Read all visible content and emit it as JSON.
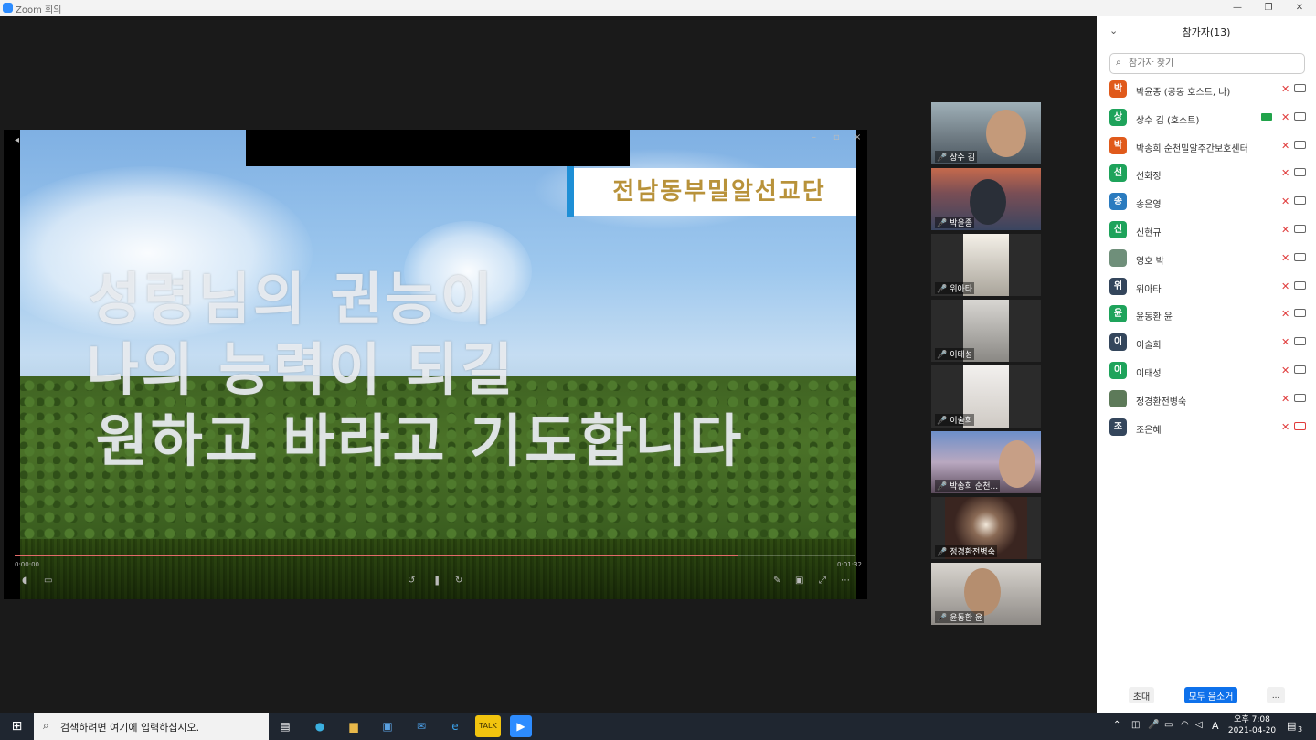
{
  "window": {
    "title": "Zoom 회의",
    "controls": [
      "—",
      "❐",
      "✕"
    ]
  },
  "share": {
    "banner": "전남동부밀알선교단",
    "lyrics": [
      "성령님의 권능이",
      "나의 능력이 되길",
      "원하고 바라고 기도합니다"
    ],
    "playback_progress": 0.86,
    "time_left": "0:00:00",
    "time_right": "0:01:32"
  },
  "gallery": [
    {
      "name": "상수 김",
      "active": false
    },
    {
      "name": "박윤종",
      "active": false
    },
    {
      "name": "위아타",
      "active": false
    },
    {
      "name": "이태성",
      "active": false
    },
    {
      "name": "이술희",
      "active": false
    },
    {
      "name": "박송희 순천...",
      "active": false
    },
    {
      "name": "정경환전병숙",
      "active": true
    },
    {
      "name": "윤동환 윤",
      "active": false
    }
  ],
  "participants_panel": {
    "title": "참가자(13)",
    "search_placeholder": "참가자 찾기",
    "participants": [
      {
        "initial": "박",
        "name": "박윤종 (공동 호스트, 나)",
        "color": "#e05a1b",
        "sharing": false,
        "video_off": false
      },
      {
        "initial": "상",
        "name": "상수 김 (호스트)",
        "color": "#1ea35b",
        "sharing": true,
        "video_off": false
      },
      {
        "initial": "박",
        "name": "박송희 순천밀알주간보호센터",
        "color": "#e05a1b",
        "sharing": false,
        "video_off": false
      },
      {
        "initial": "선",
        "name": "선화정",
        "color": "#1ea35b",
        "sharing": false,
        "video_off": false
      },
      {
        "initial": "송",
        "name": "송은영",
        "color": "#2a7bbf",
        "sharing": false,
        "video_off": false
      },
      {
        "initial": "신",
        "name": "신현규",
        "color": "#1ea35b",
        "sharing": false,
        "video_off": false
      },
      {
        "initial": "",
        "name": "영호 박",
        "color": "#6f8f7a",
        "sharing": false,
        "video_off": false
      },
      {
        "initial": "위",
        "name": "위아타",
        "color": "#34465c",
        "sharing": false,
        "video_off": false
      },
      {
        "initial": "윤",
        "name": "윤동환 윤",
        "color": "#1ea35b",
        "sharing": false,
        "video_off": false
      },
      {
        "initial": "이",
        "name": "이술희",
        "color": "#34465c",
        "sharing": false,
        "video_off": false
      },
      {
        "initial": "이",
        "name": "이태성",
        "color": "#1ea35b",
        "sharing": false,
        "video_off": false
      },
      {
        "initial": "",
        "name": "정경환전병숙",
        "color": "#5d7a59",
        "sharing": false,
        "video_off": false
      },
      {
        "initial": "조",
        "name": "조은혜",
        "color": "#34465c",
        "sharing": false,
        "video_off": true
      }
    ],
    "footer": {
      "invite": "초대",
      "mute_all": "모두 음소거",
      "more": "..."
    }
  },
  "taskbar": {
    "search_placeholder": "검색하려면 여기에 입력하십시오.",
    "apps": [
      "task-view",
      "edge",
      "file-explorer",
      "store",
      "mail",
      "internet-explorer",
      "kakaotalk",
      "zoom"
    ],
    "clock_time": "오후 7:08",
    "clock_date": "2021-04-20",
    "notification_count": "3",
    "ime": "A"
  }
}
